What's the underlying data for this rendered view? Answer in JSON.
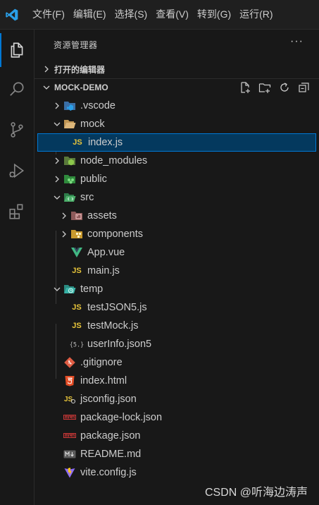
{
  "menu": [
    "文件(F)",
    "编辑(E)",
    "选择(S)",
    "查看(V)",
    "转到(G)",
    "运行(R)"
  ],
  "activity": [
    "explorer-icon",
    "search-icon",
    "source-control-icon",
    "run-debug-icon",
    "extensions-icon"
  ],
  "sidebar": {
    "title": "资源管理器",
    "more": "···",
    "open_editors": "打开的编辑器",
    "project": "MOCK-DEMO",
    "project_actions": [
      "new-file-icon",
      "new-folder-icon",
      "refresh-icon",
      "collapse-all-icon"
    ]
  },
  "tree": [
    {
      "name": ".vscode",
      "type": "folder",
      "expanded": false,
      "icon": "vscode-folder-icon"
    },
    {
      "name": "mock",
      "type": "folder",
      "expanded": true,
      "icon": "folder-open-icon"
    },
    {
      "name": "index.js",
      "type": "file",
      "icon": "js-file-icon",
      "selected": true
    },
    {
      "name": "node_modules",
      "type": "folder",
      "expanded": false,
      "icon": "node-folder-icon"
    },
    {
      "name": "public",
      "type": "folder",
      "expanded": false,
      "icon": "public-folder-icon"
    },
    {
      "name": "src",
      "type": "folder",
      "expanded": true,
      "icon": "src-folder-icon"
    },
    {
      "name": "assets",
      "type": "folder",
      "expanded": false,
      "icon": "assets-folder-icon"
    },
    {
      "name": "components",
      "type": "folder",
      "expanded": false,
      "icon": "components-folder-icon"
    },
    {
      "name": "App.vue",
      "type": "file",
      "icon": "vue-file-icon"
    },
    {
      "name": "main.js",
      "type": "file",
      "icon": "js-file-icon"
    },
    {
      "name": "temp",
      "type": "folder",
      "expanded": true,
      "icon": "temp-folder-icon"
    },
    {
      "name": "testJSON5.js",
      "type": "file",
      "icon": "js-file-icon"
    },
    {
      "name": "testMock.js",
      "type": "file",
      "icon": "js-file-icon"
    },
    {
      "name": "userInfo.json5",
      "type": "file",
      "icon": "json5-file-icon"
    },
    {
      "name": ".gitignore",
      "type": "file",
      "icon": "git-file-icon"
    },
    {
      "name": "index.html",
      "type": "file",
      "icon": "html5-file-icon"
    },
    {
      "name": "jsconfig.json",
      "type": "file",
      "icon": "jsconfig-file-icon"
    },
    {
      "name": "package-lock.json",
      "type": "file",
      "icon": "npm-file-icon"
    },
    {
      "name": "package.json",
      "type": "file",
      "icon": "npm-file-icon"
    },
    {
      "name": "README.md",
      "type": "file",
      "icon": "markdown-file-icon"
    },
    {
      "name": "vite.config.js",
      "type": "file",
      "icon": "vite-file-icon"
    }
  ],
  "watermark": "CSDN @听海边涛声",
  "colors": {
    "accent": "#0078d4",
    "selected_bg": "#04395e",
    "js": "#e8c53a"
  }
}
